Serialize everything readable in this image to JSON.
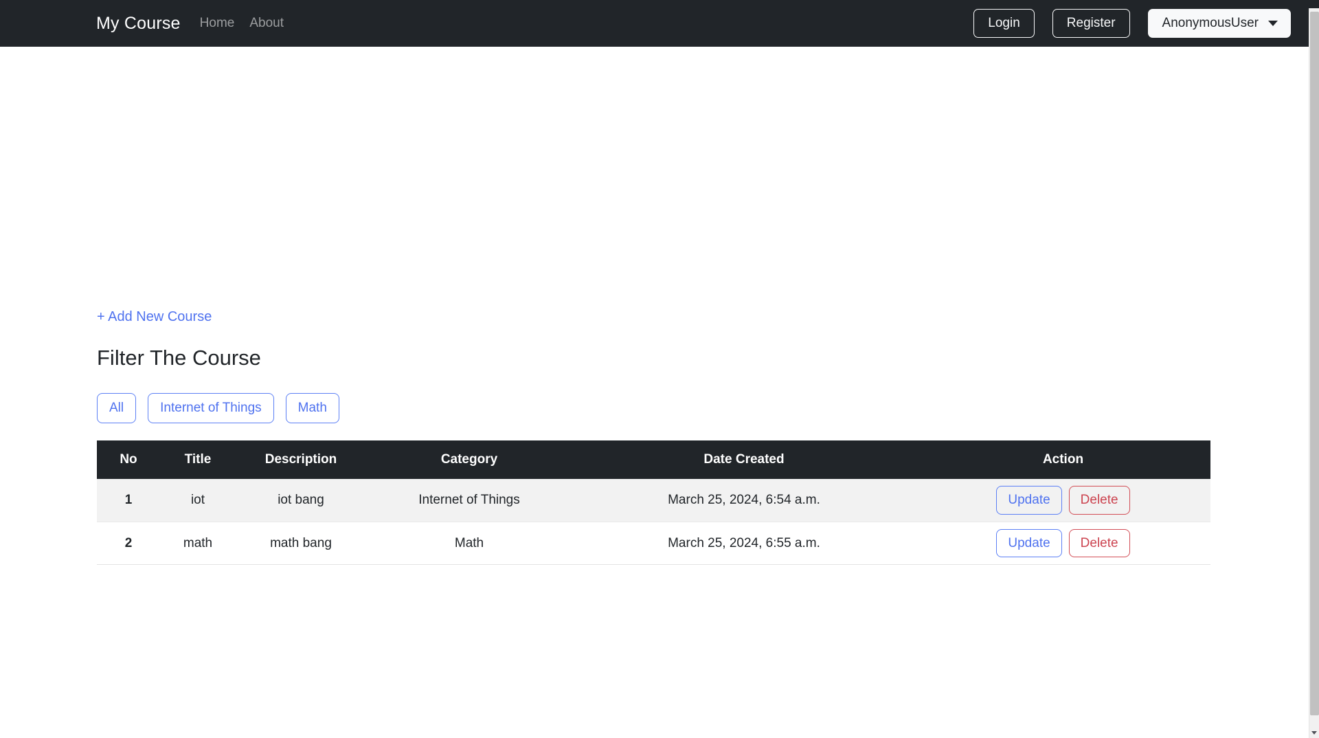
{
  "navbar": {
    "brand": "My Course",
    "links": [
      {
        "label": "Home"
      },
      {
        "label": "About"
      }
    ],
    "login_label": "Login",
    "register_label": "Register",
    "user_label": "AnonymousUser",
    "background_color": "#212529",
    "brand_color": "#ffffff",
    "link_color": "rgba(255,255,255,0.55)"
  },
  "main": {
    "add_new_course_label": "+ Add New Course",
    "filter_heading": "Filter The Course",
    "filter_buttons": [
      {
        "label": "All"
      },
      {
        "label": "Internet of Things"
      },
      {
        "label": "Math"
      }
    ],
    "link_color": "#4f72ef",
    "primary_color": "#4f72ef",
    "danger_color": "#cc4450"
  },
  "table": {
    "headers": {
      "no": "No",
      "title": "Title",
      "description": "Description",
      "category": "Category",
      "date_created": "Date Created",
      "action": "Action"
    },
    "header_background": "#212529",
    "stripe_background": "#f2f2f2",
    "rows": [
      {
        "no": "1",
        "title": "iot",
        "description": "iot bang",
        "category": "Internet of Things",
        "date_created": "March 25, 2024, 6:54 a.m.",
        "update_label": "Update",
        "delete_label": "Delete"
      },
      {
        "no": "2",
        "title": "math",
        "description": "math bang",
        "category": "Math",
        "date_created": "March 25, 2024, 6:55 a.m.",
        "update_label": "Update",
        "delete_label": "Delete"
      }
    ]
  }
}
